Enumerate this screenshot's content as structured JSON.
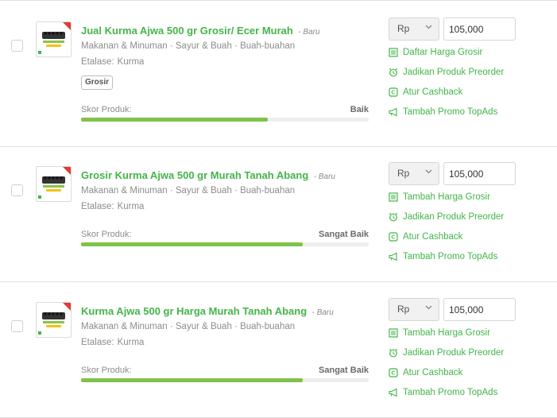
{
  "products": [
    {
      "title": "Jual Kurma Ajwa 500 gr Grosir/ Ecer Murah",
      "badge": "- Baru",
      "category": "Makanan & Minuman  ·  Sayur & Buah  ·  Buah-buahan",
      "etalase_label": "Etalase:",
      "etalase_value": "Kurma",
      "tag": "Grosir",
      "score_label": "Skor Produk:",
      "score_value": "Baik",
      "score_fraction": 0.65,
      "currency": "Rp",
      "price": "105,000",
      "actions": [
        {
          "label": "Daftar Harga Grosir",
          "icon": "list-icon"
        },
        {
          "label": "Jadikan Produk Preorder",
          "icon": "alarm-icon"
        },
        {
          "label": "Atur Cashback",
          "icon": "cashback-icon"
        },
        {
          "label": "Tambah Promo TopAds",
          "icon": "megaphone-icon"
        }
      ]
    },
    {
      "title": "Grosir Kurma Ajwa 500 gr Murah Tanah Abang",
      "badge": "- Baru",
      "category": "Makanan & Minuman  ·  Sayur & Buah  ·  Buah-buahan",
      "etalase_label": "Etalase:",
      "etalase_value": "Kurma",
      "score_label": "Skor Produk:",
      "score_value": "Sangat Baik",
      "score_fraction": 0.77,
      "currency": "Rp",
      "price": "105,000",
      "actions": [
        {
          "label": "Tambah Harga Grosir",
          "icon": "list-icon"
        },
        {
          "label": "Jadikan Produk Preorder",
          "icon": "alarm-icon"
        },
        {
          "label": "Atur Cashback",
          "icon": "cashback-icon"
        },
        {
          "label": "Tambah Promo TopAds",
          "icon": "megaphone-icon"
        }
      ]
    },
    {
      "title": "Kurma Ajwa 500 gr Harga Murah Tanah Abang",
      "badge": "- Baru",
      "category": "Makanan & Minuman  ·  Sayur & Buah  ·  Buah-buahan",
      "etalase_label": "Etalase:",
      "etalase_value": "Kurma",
      "score_label": "Skor Produk:",
      "score_value": "Sangat Baik",
      "score_fraction": 0.77,
      "currency": "Rp",
      "price": "105,000",
      "actions": [
        {
          "label": "Tambah Harga Grosir",
          "icon": "list-icon"
        },
        {
          "label": "Jadikan Produk Preorder",
          "icon": "alarm-icon"
        },
        {
          "label": "Atur Cashback",
          "icon": "cashback-icon"
        },
        {
          "label": "Tambah Promo TopAds",
          "icon": "megaphone-icon"
        }
      ]
    }
  ],
  "colors": {
    "accent_green": "#42b549",
    "score_fill": "#80c24a",
    "thumbnail_corner": "#e53935",
    "thumbnail_band": "#f4c20d"
  }
}
